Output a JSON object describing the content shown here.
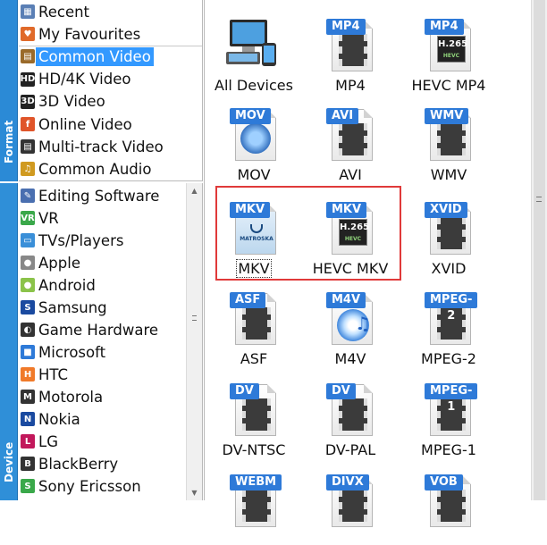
{
  "tabs": {
    "format": "Format",
    "device": "Device"
  },
  "format_list": [
    {
      "label": "Recent",
      "icon": "calendar-icon"
    },
    {
      "label": "My Favourites",
      "icon": "heart-icon"
    },
    {
      "label": "Common Video",
      "icon": "film-icon",
      "selected": true
    },
    {
      "label": "HD/4K Video",
      "icon": "hd-icon"
    },
    {
      "label": "3D Video",
      "icon": "3d-icon"
    },
    {
      "label": "Online Video",
      "icon": "online-icon"
    },
    {
      "label": "Multi-track Video",
      "icon": "multitrack-icon"
    },
    {
      "label": "Common Audio",
      "icon": "music-icon"
    }
  ],
  "device_list": [
    {
      "label": "Editing Software",
      "icon": "editing-icon"
    },
    {
      "label": "VR",
      "icon": "vr-icon"
    },
    {
      "label": "TVs/Players",
      "icon": "tv-icon"
    },
    {
      "label": "Apple",
      "icon": "apple-icon"
    },
    {
      "label": "Android",
      "icon": "android-icon"
    },
    {
      "label": "Samsung",
      "icon": "samsung-icon"
    },
    {
      "label": "Game Hardware",
      "icon": "game-icon"
    },
    {
      "label": "Microsoft",
      "icon": "microsoft-icon"
    },
    {
      "label": "HTC",
      "icon": "htc-icon"
    },
    {
      "label": "Motorola",
      "icon": "motorola-icon"
    },
    {
      "label": "Nokia",
      "icon": "nokia-icon"
    },
    {
      "label": "LG",
      "icon": "lg-icon"
    },
    {
      "label": "BlackBerry",
      "icon": "blackberry-icon"
    },
    {
      "label": "Sony Ericsson",
      "icon": "sony-ericsson-icon"
    }
  ],
  "formats": [
    {
      "name": "All Devices",
      "badge": ""
    },
    {
      "name": "MP4",
      "badge": "MP4"
    },
    {
      "name": "HEVC MP4",
      "badge": "MP4",
      "h265": true
    },
    {
      "name": "MOV",
      "badge": "MOV"
    },
    {
      "name": "AVI",
      "badge": "AVI"
    },
    {
      "name": "WMV",
      "badge": "WMV"
    },
    {
      "name": "MKV",
      "badge": "MKV"
    },
    {
      "name": "HEVC MKV",
      "badge": "MKV",
      "h265": true
    },
    {
      "name": "XVID",
      "badge": "XVID"
    },
    {
      "name": "ASF",
      "badge": "ASF"
    },
    {
      "name": "M4V",
      "badge": "M4V"
    },
    {
      "name": "MPEG-2",
      "badge": "MPEG-2"
    },
    {
      "name": "DV-NTSC",
      "badge": "DV"
    },
    {
      "name": "DV-PAL",
      "badge": "DV"
    },
    {
      "name": "MPEG-1",
      "badge": "MPEG-1"
    },
    {
      "name": "",
      "badge": "WEBM"
    },
    {
      "name": "",
      "badge": "DIVX"
    },
    {
      "name": "",
      "badge": "VOB"
    }
  ],
  "h265_label": "H.265",
  "hevc_label": "HEVC",
  "matroska_label": "MATROSKA",
  "colors": {
    "tab_blue": "#2b8ad6",
    "selection": "#3399ff",
    "badge_blue": "#2e7ad8",
    "highlight": "#e03a3a"
  }
}
